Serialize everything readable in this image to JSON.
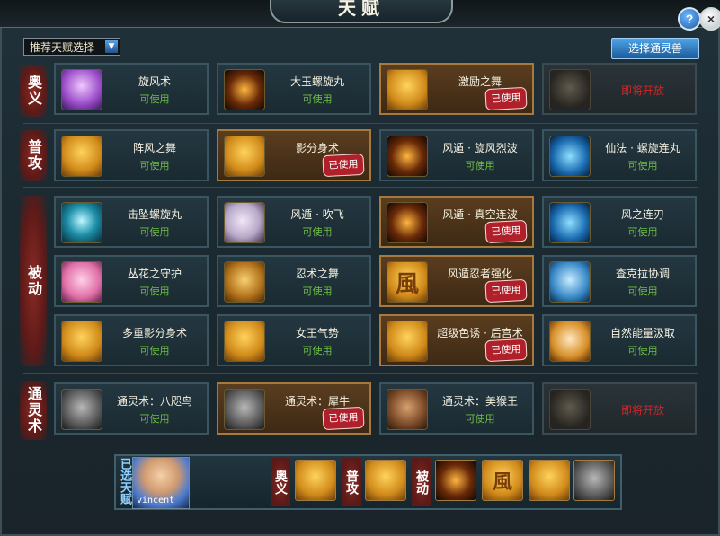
{
  "window": {
    "title": "天赋"
  },
  "controls": {
    "help_label": "?",
    "close_label": "×",
    "recommend_select": "推荐天赋选择",
    "recommend_arrow": "▼",
    "beast_button": "选择通灵兽"
  },
  "categories": [
    {
      "label": "奥义"
    },
    {
      "label": "普攻"
    },
    {
      "label": "被动"
    },
    {
      "label": "通灵术"
    }
  ],
  "rows": [
    [
      {
        "name": "旋风术",
        "status": "可使用",
        "icon": "tornado-icon",
        "color": "purple"
      },
      {
        "name": "大玉螺旋丸",
        "status": "可使用",
        "icon": "spiral-orb-icon",
        "color": "dark"
      },
      {
        "name": "激励之舞",
        "status": "已使用",
        "icon": "dancer-icon",
        "color": "gold",
        "used": true
      },
      {
        "name": "即将开放",
        "locked": true,
        "icon": "lock-icon"
      }
    ],
    [
      {
        "name": "阵风之舞",
        "status": "可使用",
        "icon": "wind-swirl-icon",
        "color": "gold"
      },
      {
        "name": "影分身术",
        "status": "已使用",
        "icon": "shadow-clone-icon",
        "color": "gold",
        "used": true
      },
      {
        "name": "风遁 · 旋风烈波",
        "status": "可使用",
        "icon": "wind-wave-icon",
        "color": "dark"
      },
      {
        "name": "仙法 · 螺旋连丸",
        "status": "可使用",
        "icon": "blue-vortex-icon",
        "color": "blue"
      }
    ],
    [
      {
        "name": "击坠螺旋丸",
        "status": "可使用",
        "icon": "energy-burst-icon",
        "color": "teal"
      },
      {
        "name": "风遁 · 吹飞",
        "status": "可使用",
        "icon": "fan-icon",
        "color": "fan"
      },
      {
        "name": "风遁 · 真空连波",
        "status": "已使用",
        "icon": "claw-slash-icon",
        "color": "dark",
        "used": true
      },
      {
        "name": "风之连刃",
        "status": "可使用",
        "icon": "wind-blade-icon",
        "color": "blue"
      }
    ],
    [
      {
        "name": "丛花之守护",
        "status": "可使用",
        "icon": "flower-girl-icon",
        "color": "pink"
      },
      {
        "name": "忍术之舞",
        "status": "可使用",
        "icon": "scroll-icon",
        "color": "scroll"
      },
      {
        "name": "风遁忍者强化",
        "status": "已使用",
        "icon": "wind-glyph-icon",
        "color": "gold",
        "used": true,
        "glyph": "風"
      },
      {
        "name": "查克拉协调",
        "status": "可使用",
        "icon": "hand-icon",
        "color": "hand"
      }
    ],
    [
      {
        "name": "多重影分身术",
        "status": "可使用",
        "icon": "multi-clone-icon",
        "color": "gold"
      },
      {
        "name": "女王气势",
        "status": "可使用",
        "icon": "queen-icon",
        "color": "gold"
      },
      {
        "name": "超级色诱 · 后宫术",
        "status": "已使用",
        "icon": "harem-icon",
        "color": "gold",
        "used": true
      },
      {
        "name": "自然能量汲取",
        "status": "可使用",
        "icon": "stopwatch-icon",
        "color": "clock"
      }
    ],
    [
      {
        "name": "通灵术：八咫鸟",
        "status": "可使用",
        "icon": "crow-icon",
        "color": "gray"
      },
      {
        "name": "通灵术：犀牛",
        "status": "已使用",
        "icon": "rhino-icon",
        "color": "gray",
        "used": true
      },
      {
        "name": "通灵术：美猴王",
        "status": "可使用",
        "icon": "monkey-king-icon",
        "color": "brown"
      },
      {
        "name": "即将开放",
        "locked": true,
        "icon": "lock-icon"
      }
    ]
  ],
  "used_stamp": "已使用",
  "selected": {
    "label": "已选天赋",
    "player_name": "vincent",
    "groups": [
      {
        "label": "奥义",
        "icons": [
          "dancer-icon"
        ]
      },
      {
        "label": "普攻",
        "icons": [
          "shadow-clone-icon"
        ]
      },
      {
        "label": "被动",
        "icons": [
          "claw-slash-icon",
          "wind-glyph-icon",
          "harem-icon",
          "rhino-icon"
        ]
      }
    ],
    "glyph": "風"
  }
}
